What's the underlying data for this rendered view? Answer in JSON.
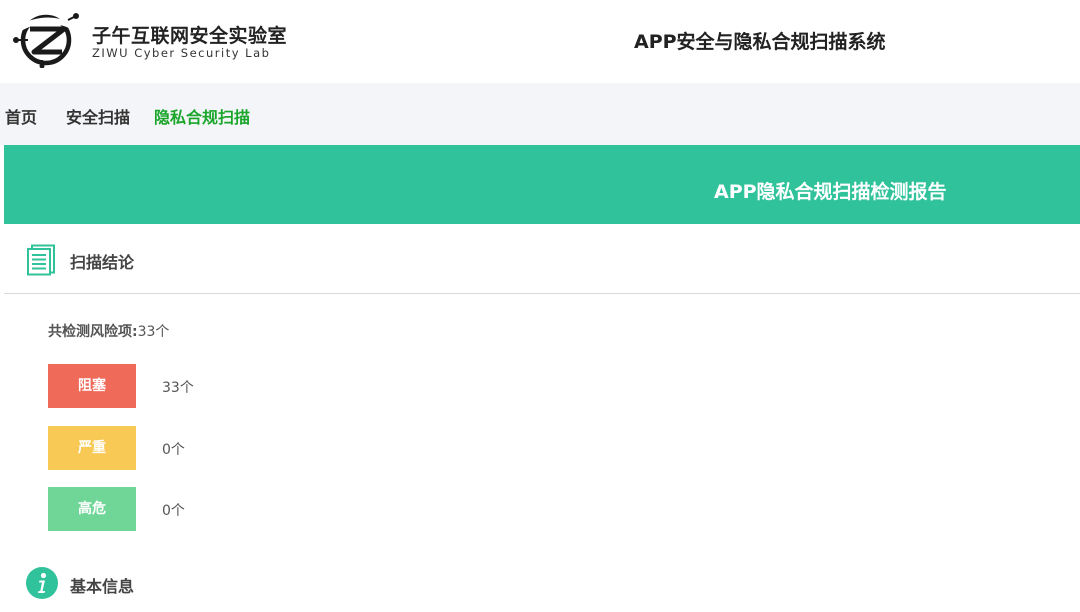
{
  "header": {
    "logo_cn": "子午互联网安全实验室",
    "logo_en": "ZIWU Cyber Security Lab",
    "system_title": "APP安全与隐私合规扫描系统"
  },
  "nav": {
    "items": [
      {
        "label": "首页",
        "active": false
      },
      {
        "label": "安全扫描",
        "active": false
      },
      {
        "label": "隐私合规扫描",
        "active": true
      }
    ]
  },
  "report": {
    "title": "APP隐私合规扫描检测报告",
    "conclusion_heading": "扫描结论",
    "total_label": "共检测风险项:",
    "total_value": "33个",
    "risks": [
      {
        "label": "阻塞",
        "count": "33个",
        "color": "#f06a5a"
      },
      {
        "label": "严重",
        "count": "0个",
        "color": "#f8ca55"
      },
      {
        "label": "高危",
        "count": "0个",
        "color": "#70d698"
      }
    ],
    "basic_info_heading": "基本信息"
  },
  "colors": {
    "accent": "#30c39b",
    "nav_active": "#1aa52b",
    "nav_bg": "#f4f5f8"
  },
  "icons": {
    "logo": "ziwu-logo-icon",
    "conclusion": "document-list-icon",
    "basic_info": "info-circle-icon"
  }
}
